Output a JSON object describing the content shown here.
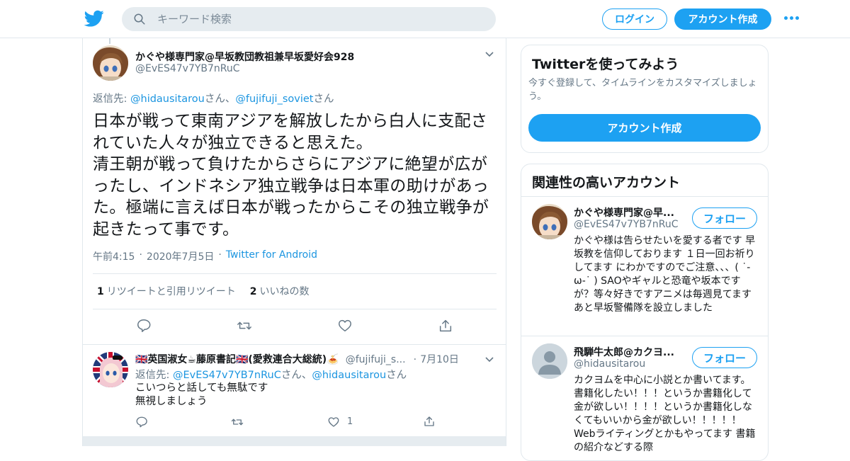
{
  "header": {
    "search_placeholder": "キーワード検索",
    "login_label": "ログイン",
    "signup_label": "アカウント作成"
  },
  "tweet": {
    "author_name": "かぐや様専門家@早坂教団教祖兼早坂愛好会928",
    "author_handle": "@EvES47v7YB7nRuC",
    "reply_prefix": "返信先: ",
    "reply_to_1": "@hidausitarou",
    "reply_sep": "さん、",
    "reply_to_2": "@fujifuji_soviet",
    "reply_suffix": "さん",
    "text": "日本が戦って東南アジアを解放したから白人に支配されていた人々が独立できると思えた。\n清王朝が戦って負けたからさらにアジアに絶望が広がったし、インドネシア独立戦争は日本軍の助けがあった。極端に言えば日本が戦ったからこその独立戦争が起きたって事です。",
    "time": "午前4:15",
    "date": "2020年7月5日",
    "dot": "·",
    "source": "Twitter for Android",
    "retweets_count": "1",
    "retweets_label": "リツイートと引用リツイート",
    "likes_count": "2",
    "likes_label": "いいねの数"
  },
  "reply": {
    "author_name": "🇬🇧英国淑女☕藤原書記🇬🇧(愛救連合大総統)🍝",
    "author_handle": "@fujifuji_s...",
    "dot": "·",
    "date": "7月10日",
    "reply_prefix": "返信先: ",
    "reply_to_1": "@EvES47v7YB7nRuC",
    "reply_sep": "さん、",
    "reply_to_2": "@hidausitarou",
    "reply_suffix": "さん",
    "line1": "こいつらと話しても無駄です",
    "line2": "無視しましょう",
    "likes": "1"
  },
  "sidebar": {
    "signup_card": {
      "title": "Twitterを使ってみよう",
      "desc": "今すぐ登録して、タイムラインをカスタマイズしましょう。",
      "button": "アカウント作成"
    },
    "related": {
      "title": "関連性の高いアカウント",
      "follow_label": "フォロー",
      "accounts": [
        {
          "name": "かぐや様専門家@早...",
          "handle": "@EvES47v7YB7nRuC",
          "bio": "かぐや様は告らせたいを愛する者です 早坂教を信仰しております １日一回お祈りしてます にわかですのでご注意、、、( ˙-ω-˙ ) SAOやギャルと恐竜や坂本ですが？等々好きですアニメは毎週見てます あと早坂警備隊を設立しました"
        },
        {
          "name": "飛騨牛太郎@カクヨ...",
          "handle": "@hidausitarou",
          "bio": "カクヨムを中心に小説とか書いてます。 書籍化したい！！！というか書籍化して金が欲しい！！！！というか書籍化しなくてもいいから金が欲しい！！！！！ Webライティングとかもやってます 書籍の紹介などする際"
        }
      ]
    }
  },
  "colors": {
    "brand": "#1da1f2",
    "link": "#1b95e0",
    "text": "#14171a",
    "muted": "#657786",
    "border": "#e1e8ed"
  },
  "icons": [
    "twitter-logo-icon",
    "search-icon",
    "more-dots-icon",
    "chevron-down-icon",
    "reply-icon",
    "retweet-icon",
    "like-icon",
    "share-icon",
    "default-avatar-icon"
  ]
}
